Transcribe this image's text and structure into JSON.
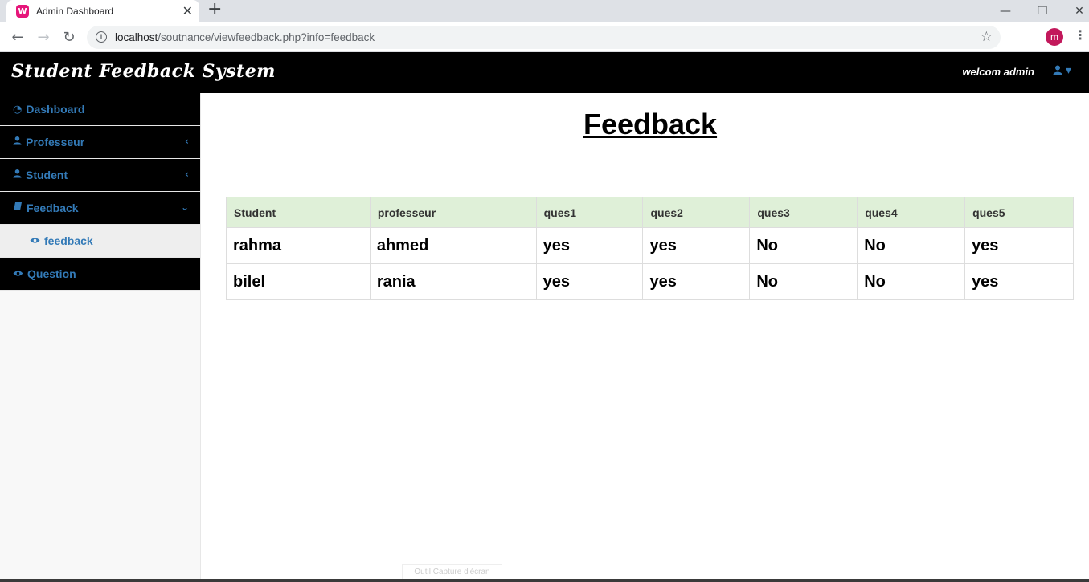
{
  "browser": {
    "tab_title": "Admin Dashboard",
    "tab_favicon": "W",
    "tab_close": "✕",
    "new_tab": "+",
    "url_host": "localhost",
    "url_path": "/soutnance/viewfeedback.php?info=feedback",
    "avatar_letter": "m",
    "controls": {
      "minimize": "—",
      "restore": "❐",
      "close": "✕"
    },
    "nav": {
      "back": "←",
      "forward": "→",
      "reload": "↻",
      "info": "i",
      "star": "☆",
      "menu": "⋮"
    }
  },
  "navbar": {
    "brand": "Student Feedback System",
    "welcome": "welcom admin",
    "user_icon": "user-icon",
    "caret": "▾"
  },
  "sidebar": {
    "items": [
      {
        "label": "Dashboard",
        "icon": "dashboard-icon",
        "glyph": "◔",
        "arrow": ""
      },
      {
        "label": "Professeur",
        "icon": "user-icon",
        "glyph": "👤",
        "arrow": "‹"
      },
      {
        "label": "Student",
        "icon": "user-icon",
        "glyph": "👤",
        "arrow": "‹"
      },
      {
        "label": "Feedback",
        "icon": "book-icon",
        "glyph": "📘",
        "arrow": "⌄"
      }
    ],
    "sub_items": [
      {
        "label": "feedback",
        "icon": "eye-icon",
        "glyph": "👁"
      }
    ],
    "last_item": {
      "label": "Question",
      "icon": "eye-icon",
      "glyph": "👁"
    }
  },
  "main": {
    "title": "Feedback",
    "table": {
      "headers": [
        "Student",
        "professeur",
        "ques1",
        "ques2",
        "ques3",
        "ques4",
        "ques5"
      ],
      "rows": [
        [
          "rahma",
          "ahmed",
          "yes",
          "yes",
          "No",
          "No",
          "yes"
        ],
        [
          "bilel",
          "rania",
          "yes",
          "yes",
          "No",
          "No",
          "yes"
        ]
      ]
    }
  },
  "overlay": {
    "hint": "Outil Capture d'écran"
  },
  "colors": {
    "accent": "#337ab7",
    "header_bg": "#dff0d8",
    "navbar_bg": "#000000",
    "sidebar_bg": "#f8f8f8"
  }
}
